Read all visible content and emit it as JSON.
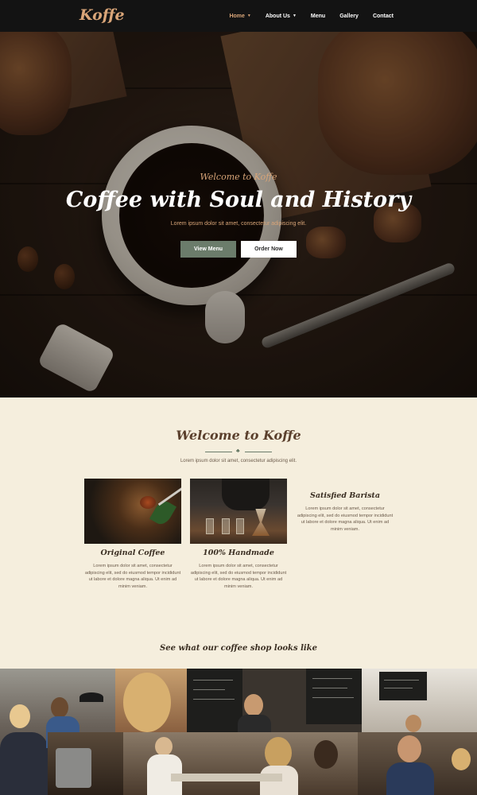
{
  "nav": {
    "logo": "Koffe",
    "items": [
      {
        "label": "Home",
        "active": true,
        "dropdown": true
      },
      {
        "label": "About Us",
        "active": false,
        "dropdown": true
      },
      {
        "label": "Menu",
        "active": false,
        "dropdown": false
      },
      {
        "label": "Gallery",
        "active": false,
        "dropdown": false
      },
      {
        "label": "Contact",
        "active": false,
        "dropdown": false
      }
    ]
  },
  "hero": {
    "subtitle": "Welcome to Koffe",
    "title": "Coffee with Soul and History",
    "description": "Lorem ipsum dolor sit amet, consectetur adipiscing elit.",
    "btn_menu": "View Menu",
    "btn_order": "Order Now"
  },
  "welcome": {
    "title": "Welcome to Koffe",
    "description": "Lorem ipsum dolor sit amet, consectetur adipiscing elit."
  },
  "features": [
    {
      "title": "Original Coffee",
      "text": "Lorem ipsum dolor sit amet, consectetur adipiscing elit, sed do eiusmod tempor incididunt ut labore et dolore magna aliqua. Ut enim ad minim veniam."
    },
    {
      "title": "100% Handmade",
      "text": "Lorem ipsum dolor sit amet, consectetur adipiscing elit, sed do eiusmod tempor incididunt ut labore et dolore magna aliqua. Ut enim ad minim veniam."
    },
    {
      "title": "Satisfied Barista",
      "text": "Lorem ipsum dolor sit amet, consectetur adipiscing elit, sed do eiusmod tempor incididunt ut labore et dolore magna aliqua. Ut enim ad minim veniam."
    }
  ],
  "showcase": {
    "title": "See what our coffee shop looks like"
  },
  "colors": {
    "accent": "#d9a578",
    "nav_bg": "#131313",
    "section_bg": "#f5eedd",
    "button_green": "#6b7c6b",
    "heading_brown": "#5a3f2c"
  },
  "icons": {
    "dropdown": "chevron-down-icon",
    "divider": "leaf-icon"
  }
}
